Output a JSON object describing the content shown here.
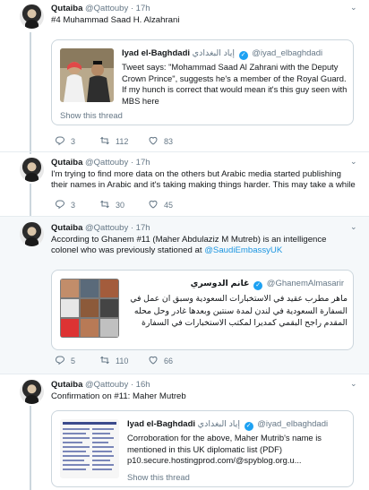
{
  "tweets": [
    {
      "name": "Qutaiba",
      "handle": "@Qattouby",
      "time": "17h",
      "text": "#4 Muhammad Saad H. Alzahrani",
      "quote": {
        "name": "Iyad el-Baghdadi",
        "name_ar": "إياد البغدادي",
        "handle": "@iyad_elbaghdadi",
        "text": "Tweet says: \"Mohammad Saad Al Zahrani with the Deputy Crown Prince\", suggests he's a member of the Royal Guard. If my hunch is correct that would mean it's this guy seen with MBS here",
        "show": "Show this thread"
      },
      "replies": "3",
      "retweets": "112",
      "likes": "83"
    },
    {
      "name": "Qutaiba",
      "handle": "@Qattouby",
      "time": "17h",
      "text": "I'm trying to find more data on the others but Arabic media started publishing their names in Arabic and it's taking making things harder. This may take a while",
      "replies": "3",
      "retweets": "30",
      "likes": "45"
    },
    {
      "name": "Qutaiba",
      "handle": "@Qattouby",
      "time": "17h",
      "text_before": "According to Ghanem #11 (Maher Abdulaziz M Mutreb) is an intelligence colonel who was previously stationed at ",
      "text_link": "@SaudiEmbassyUK",
      "quote": {
        "name": "غانم الدوسري",
        "handle": "@GhanemAlmasarir",
        "text": "ماهر مطرب عقيد في الاستخبارات السعودية وسبق ان عمل في السفارة السعودية في لندن لمدة سنتين وبعدها غادر وحل محله المقدم راجح البقمي كمديرا لمكتب الاستخبارات في السفارة"
      },
      "replies": "5",
      "retweets": "110",
      "likes": "66"
    },
    {
      "name": "Qutaiba",
      "handle": "@Qattouby",
      "time": "16h",
      "text": "Confirmation on #11: Maher Mutreb",
      "quote": {
        "name": "Iyad el-Baghdadi",
        "name_ar": "إياد البغدادي",
        "handle": "@iyad_elbaghdadi",
        "text": "Corroboration for the above, Maher Mutrib's name is mentioned in this UK diplomatic list (PDF) p10.secure.hostingprod.com/@spyblog.org.u...",
        "show": "Show this thread"
      }
    }
  ],
  "icons": {
    "reply": "reply-icon",
    "retweet": "retweet-icon",
    "like": "heart-icon",
    "caret": "chevron-down-icon"
  },
  "colors": {
    "link": "#1b95e0",
    "verified": "#1da1f2",
    "muted": "#657786",
    "highlight": "#f5f8fa"
  }
}
